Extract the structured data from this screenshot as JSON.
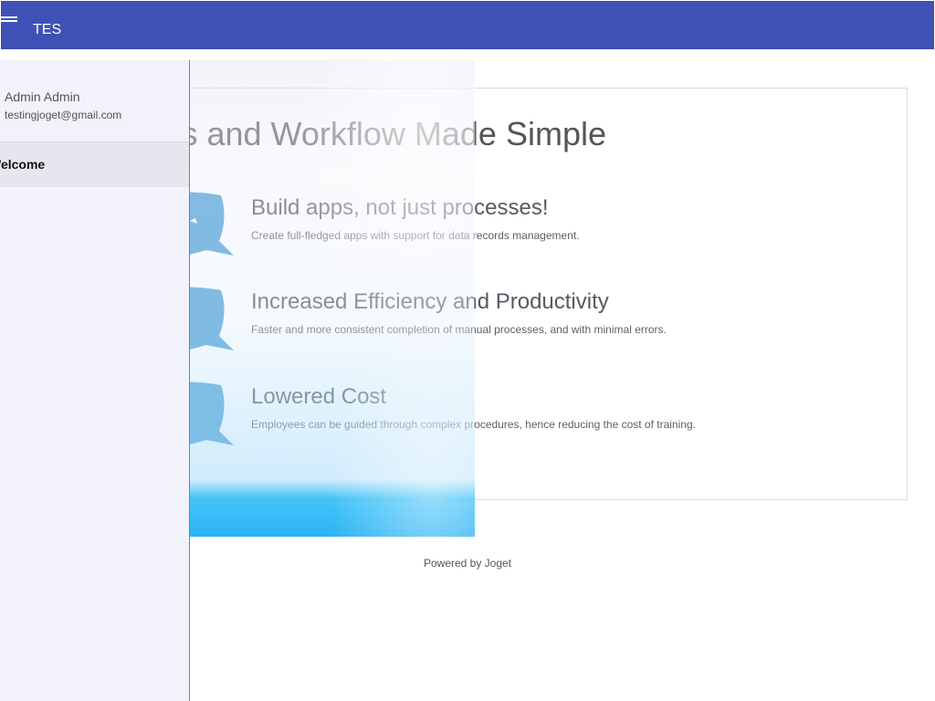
{
  "header": {
    "app_title": "TES",
    "menu_icon": "hamburger-icon",
    "background_color": "#3f51b5"
  },
  "drawer": {
    "user_name": "Admin Admin",
    "user_email": "testingjoget@gmail.com",
    "items": [
      {
        "label": "Welcome",
        "active": true
      }
    ],
    "background_color": "#f1f2fa"
  },
  "main": {
    "hero_title": "Apps and Workflow Made Simple",
    "features": [
      {
        "icon": "speech-bubble-icon",
        "title": "Build apps, not just processes!",
        "description": "Create full-fledged apps with support for data records management."
      },
      {
        "icon": "speech-bubble-icon",
        "title": "Increased Efficiency and Productivity",
        "description": "Faster and more consistent completion of manual processes, and with minimal errors."
      },
      {
        "icon": "speech-bubble-icon",
        "title": "Lowered Cost",
        "description": "Employees can be guided through complex procedures, hence reducing the cost of training."
      }
    ],
    "accent_color": "#4a9fd4"
  },
  "footer": {
    "text": "Powered by Joget"
  }
}
